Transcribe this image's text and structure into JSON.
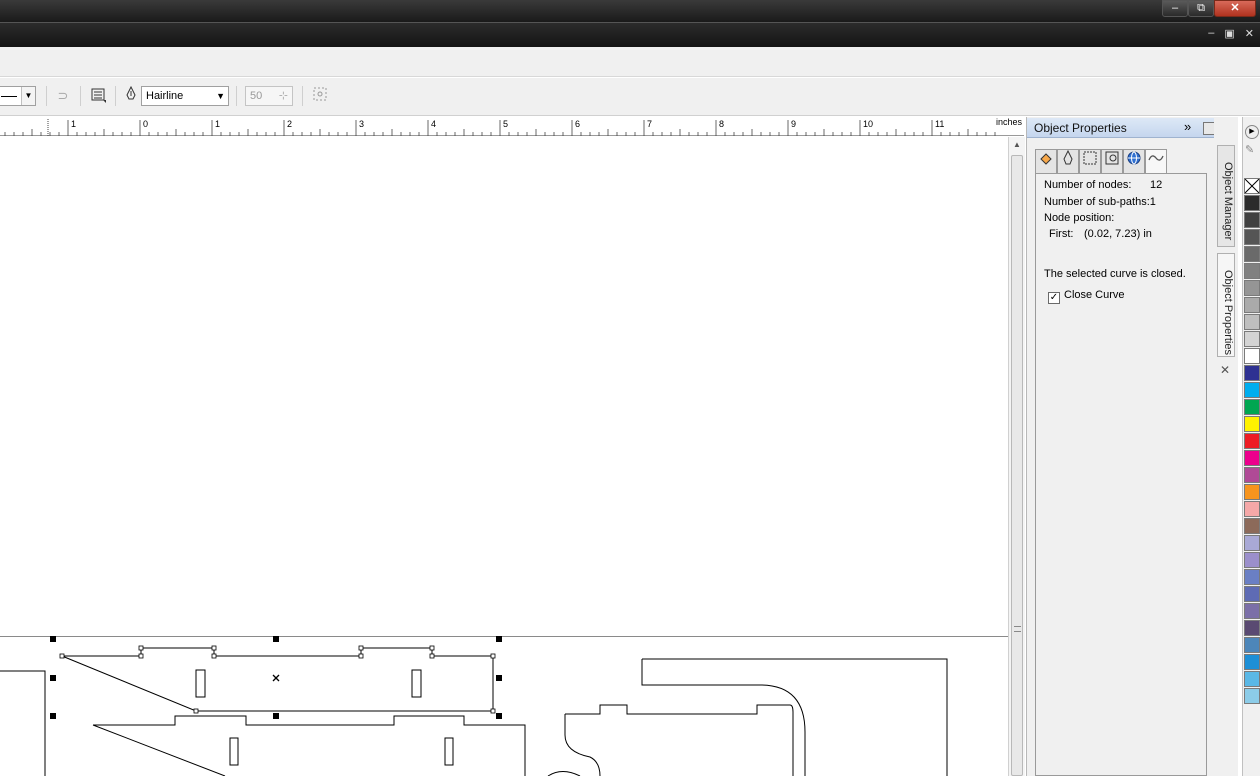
{
  "window": {
    "minimize": "–",
    "restore": "⧉",
    "close": "✕",
    "mdi_minimize": "–",
    "mdi_restore": "▣",
    "mdi_close": "✕"
  },
  "propertybar": {
    "outline_width": "Hairline",
    "miter_value": "50"
  },
  "ruler": {
    "unit": "inches",
    "ticks": [
      "1",
      "0",
      "1",
      "2",
      "3",
      "4",
      "5",
      "6",
      "7",
      "8",
      "9",
      "10",
      "11"
    ]
  },
  "docker": {
    "title": "Object Properties",
    "tab_icons": [
      "fill-icon",
      "outline-icon",
      "general-icon",
      "summary-icon",
      "internet-icon",
      "curve-icon"
    ],
    "nodes_label": "Number of nodes:",
    "nodes_value": "12",
    "subpaths_label": "Number of sub-paths:",
    "subpaths_value": "1",
    "node_position_label": "Node position:",
    "first_label": "First:",
    "first_value": "(0.02, 7.23) in",
    "status_text": "The selected curve is closed.",
    "close_curve_label": "Close Curve",
    "close_curve_checked": true
  },
  "side_tabs": {
    "object_manager": "Object Manager",
    "object_properties": "Object Properties"
  },
  "palette": {
    "colors": [
      "#2b2b2b",
      "#404040",
      "#555555",
      "#6a6a6a",
      "#808080",
      "#959595",
      "#aaaaaa",
      "#bfbfbf",
      "#d4d4d4",
      "#ffffff",
      "#2e3192",
      "#00aeef",
      "#00a651",
      "#fff200",
      "#ed1c24",
      "#ec008c",
      "#b04a96",
      "#f7941d",
      "#f5a8a8",
      "#8c6a5a",
      "#a9a9d6",
      "#9b8fcb",
      "#6a7fc4",
      "#5e6bb4",
      "#7b6fa8",
      "#5a4a72",
      "#4d86b9",
      "#1d8fd6",
      "#5ab8e6",
      "#8ccce8"
    ]
  }
}
